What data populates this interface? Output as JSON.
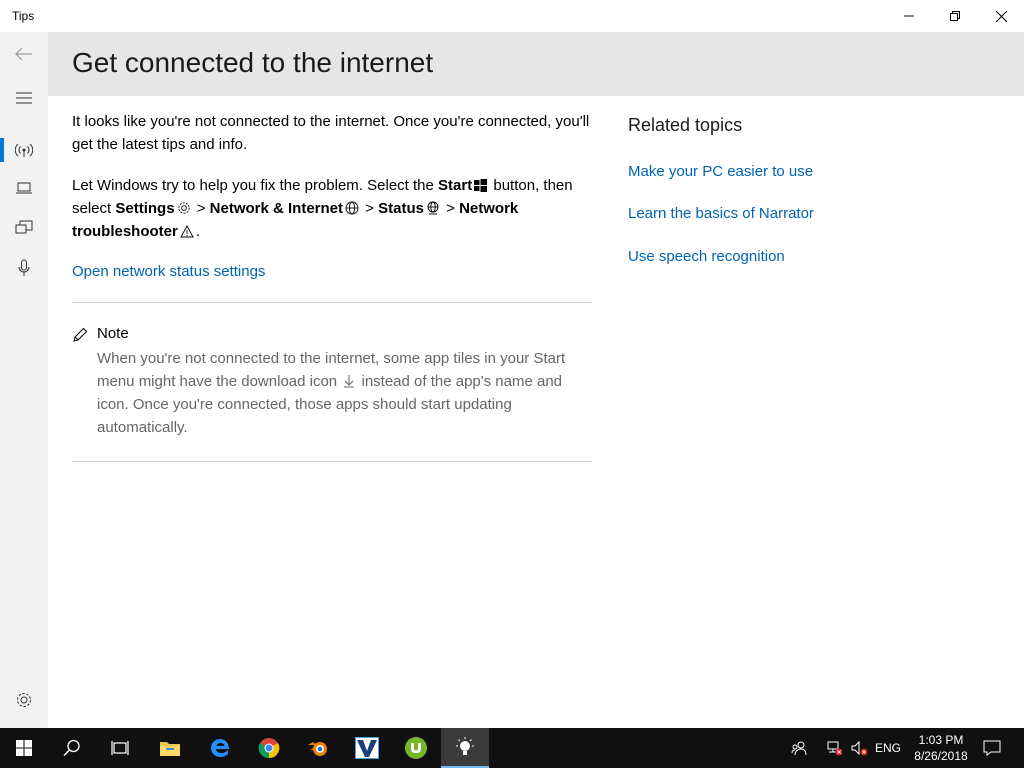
{
  "window": {
    "app_title": "Tips"
  },
  "header": {
    "title": "Get connected to the internet"
  },
  "content": {
    "para1": "It looks like you're not connected to the internet. Once you're connected, you'll get the latest tips and info.",
    "para2": {
      "t1": "Let Windows try to help you fix the problem. Select the ",
      "start": "Start",
      "t2": " button, then select ",
      "settings": "Settings",
      "sep1": " > ",
      "network_internet": "Network & Internet",
      "sep2": " > ",
      "status": "Status",
      "sep3": " > ",
      "network_troubleshooter": "Network troubleshooter",
      "t3": "."
    },
    "open_link": "Open network status settings",
    "note": {
      "title": "Note",
      "text_part1": "When you're not connected to the internet, some app tiles in your Start menu might have the download icon ",
      "text_part2": " instead of the app's name and icon. Once you're connected, those apps should start updating automatically."
    }
  },
  "related": {
    "title": "Related topics",
    "links": [
      "Make your PC easier to use",
      "Learn the basics of Narrator",
      "Use speech recognition"
    ]
  },
  "taskbar": {
    "language": "ENG",
    "time": "1:03 PM",
    "date": "8/26/2018"
  },
  "colors": {
    "accent": "#0078d7",
    "link": "#0063b1",
    "header_band": "#e6e6e6",
    "sidebar": "#f2f2f2",
    "taskbar": "#101010"
  }
}
